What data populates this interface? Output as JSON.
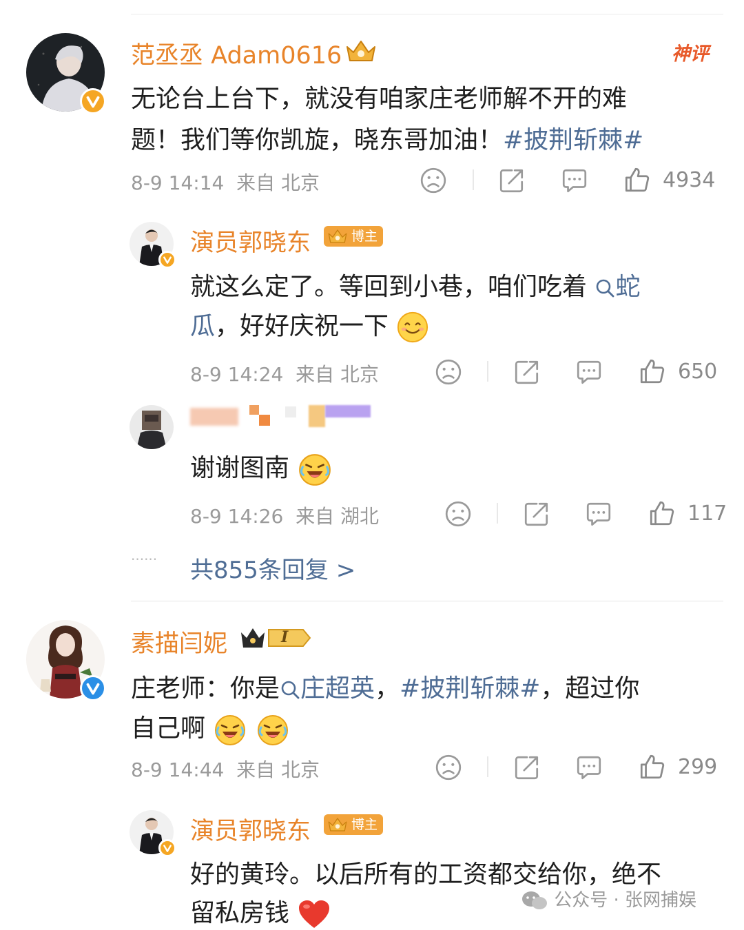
{
  "comments": [
    {
      "name": "范丞丞 Adam0616",
      "hot_label": "神评",
      "line1_text": "无论台上台下，就没有咱家庄老师解不开的难",
      "line2_text": "题！我们等你凯旋，晓东哥加油！",
      "line2_hashtag": "#披荆斩棘#",
      "time": "8-9 14:14",
      "location": "来自 北京",
      "likes": "4934"
    },
    {
      "name": "素描闫妮",
      "level_badge": "I",
      "line1_prefix": "庄老师：你是",
      "line1_link": "庄超英",
      "line1_punct": "，",
      "line1_hashtag": "#披荆斩棘#",
      "line1_suffix": "，超过你",
      "line2_text": "自己啊",
      "time": "8-9 14:44",
      "location": "来自 北京",
      "likes": "299"
    }
  ],
  "replies": [
    {
      "name": "演员郭晓东",
      "blogger_tag": "博主",
      "line1_text": "就这么定了。等回到小巷，咱们吃着",
      "line1_link": "蛇",
      "line2_link": "瓜",
      "line2_text": "，好好庆祝一下",
      "time": "8-9 14:24",
      "location": "来自 北京",
      "likes": "650"
    },
    {
      "text": "谢谢图南",
      "time": "8-9 14:26",
      "location": "来自 湖北",
      "likes": "117"
    },
    {
      "name": "演员郭晓东",
      "blogger_tag": "博主",
      "line1_text": "好的黄玲。以后所有的工资都交给你，绝不",
      "line2_text": "留私房钱"
    }
  ],
  "more_replies": {
    "dots": "······",
    "label": "共855条回复 >"
  },
  "watermark": "公众号 · 张网捕娱",
  "colors": {
    "name": "#e8842a",
    "link": "#4f6d95",
    "meta": "#9a9a9a",
    "verified_gold": "#f5a623",
    "verified_blue": "#2b8fe6"
  },
  "icons": [
    "dislike-icon",
    "share-icon",
    "comment-icon",
    "like-icon",
    "search-link-icon",
    "crown-icon",
    "smile-emoji",
    "heart-emoji"
  ]
}
